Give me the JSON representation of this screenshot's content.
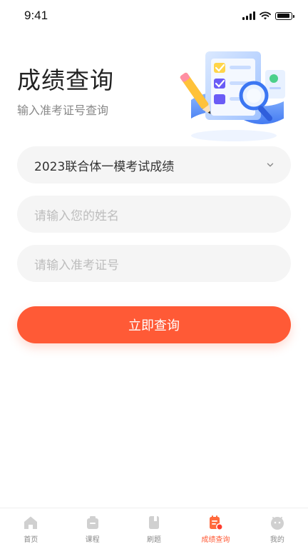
{
  "status_bar": {
    "time": "9:41"
  },
  "page": {
    "title": "成绩查询",
    "subtitle": "输入准考证号查询"
  },
  "form": {
    "exam_select_value": "2023联合体一模考试成绩",
    "name_placeholder": "请输入您的姓名",
    "ticket_placeholder": "请输入准考证号",
    "submit_label": "立即查询"
  },
  "tabbar": {
    "items": [
      {
        "label": "首页",
        "icon": "home-icon",
        "active": false
      },
      {
        "label": "课程",
        "icon": "course-icon",
        "active": false
      },
      {
        "label": "刷题",
        "icon": "practice-icon",
        "active": false
      },
      {
        "label": "成绩查询",
        "icon": "score-query-icon",
        "active": true
      },
      {
        "label": "我的",
        "icon": "profile-icon",
        "active": false
      }
    ]
  },
  "colors": {
    "accent": "#ff5a36",
    "field_bg": "#f5f5f5",
    "placeholder": "#bdbdbd",
    "tab_inactive": "#8a8a8a"
  }
}
